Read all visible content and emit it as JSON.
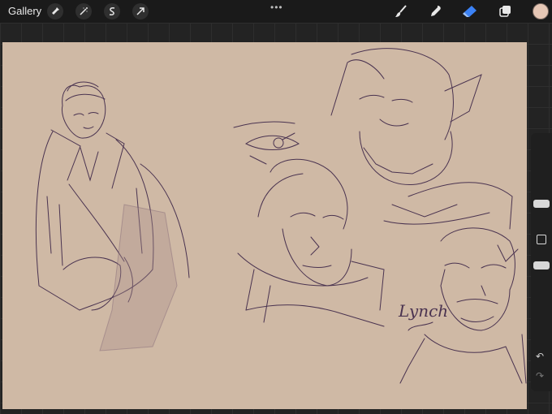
{
  "topbar": {
    "gallery_label": "Gallery",
    "left_tools": [
      {
        "name": "wrench-icon"
      },
      {
        "name": "magic-wand-icon"
      },
      {
        "name": "selection-s-icon"
      },
      {
        "name": "transform-arrow-icon"
      }
    ],
    "center_menu": "•••",
    "right_tools": [
      {
        "name": "brush-icon"
      },
      {
        "name": "smudge-icon"
      },
      {
        "name": "eraser-icon",
        "active_color": "#3b82f6"
      },
      {
        "name": "layers-icon"
      }
    ],
    "current_color": "#e6c7b5"
  },
  "canvas": {
    "background": "#cfb9a5",
    "ink_color": "#4a3350",
    "annotation_text": "Lynch"
  },
  "sidebar": {
    "brush_size": 0.7,
    "opacity": 0.2,
    "icons": [
      "undo-icon",
      "redo-icon"
    ]
  }
}
